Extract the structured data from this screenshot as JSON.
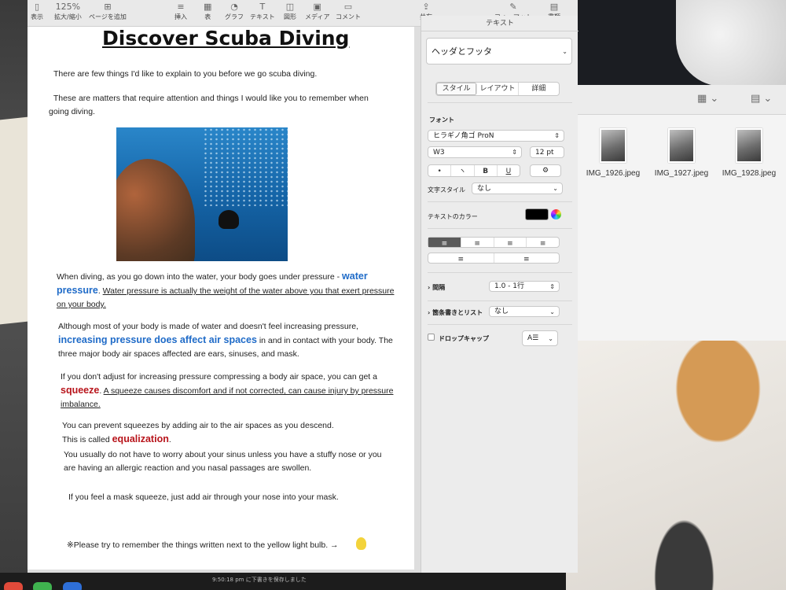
{
  "toolbar": {
    "items": [
      {
        "label": "表示",
        "icon": "sidebar-icon"
      },
      {
        "label": "拡大/縮小",
        "icon": "zoom-value",
        "value": "125%"
      },
      {
        "label": "ページを追加",
        "icon": "plus-icon"
      },
      {
        "label": "挿入",
        "icon": "list-icon"
      },
      {
        "label": "表",
        "icon": "table-icon"
      },
      {
        "label": "グラフ",
        "icon": "chart-icon"
      },
      {
        "label": "テキスト",
        "icon": "text-icon"
      },
      {
        "label": "図形",
        "icon": "shape-icon"
      },
      {
        "label": "メディア",
        "icon": "media-icon"
      },
      {
        "label": "コメント",
        "icon": "comment-icon"
      },
      {
        "label": "共有",
        "icon": "share-icon"
      },
      {
        "label": "フォーマット",
        "icon": "format-icon"
      },
      {
        "label": "書類",
        "icon": "document-icon"
      }
    ]
  },
  "document": {
    "title": "Discover Scuba Diving",
    "p1": "There are few things I'd like to explain to you before we go scuba diving.",
    "p2": "These are matters that require attention and things I would like you to remember when going diving.",
    "p3_a": "When diving, as you go down into the water, your body goes under pressure - ",
    "p3_hl": "water pressure",
    "p3_b": ". ",
    "p3_u": "Water pressure is actually the weight of the water above you that exert pressure on your body.",
    "p4_a": "Although most of your body is made of water and doesn't feel increasing pressure, ",
    "p4_hl": "increasing pressure does affect air spaces",
    "p4_b": " in and in contact with your body. The three major body air spaces affected are ears, sinuses, and mask.",
    "p5_a": "If you don't adjust for increasing pressure compressing a body air space, you can get a ",
    "p5_hl": "squeeze",
    "p5_b": ". ",
    "p5_u": "A squeeze causes discomfort and if not corrected, can cause injury by pressure imbalance.",
    "p6_a": "You can prevent squeezes by adding air to the air spaces as you descend.",
    "p6_b": "This is called ",
    "p6_hl": "equalization",
    "p6_c": ".",
    "p7": "You usually do not have to worry about your sinus unless you have a stuffy nose or you are having an allergic reaction and you nasal passages are swollen.",
    "p8": "If you feel a mask squeeze, just add air through your nose into your mask.",
    "note": "※Please try to remember the things written next to  the yellow light bulb.  →"
  },
  "inspector": {
    "header": "テキスト",
    "style_preset": "ヘッダとフッタ",
    "tabs": [
      "スタイル",
      "レイアウト",
      "詳細"
    ],
    "font_section": "フォント",
    "font_family": "ヒラギノ角ゴ ProN",
    "font_weight": "W3",
    "font_size": "12 pt",
    "format_buttons": [
      "•",
      "ヽ",
      "B",
      "U",
      "⚙"
    ],
    "char_style_label": "文字スタイル",
    "char_style_value": "なし",
    "text_color_label": "テキストのカラー",
    "text_color": "#000000",
    "spacing_label": "間隔",
    "spacing_value": "1.0 - 1行",
    "bullets_label": "箇条書きとリスト",
    "bullets_value": "なし",
    "dropcap_label": "ドロップキャップ"
  },
  "finder": {
    "files": [
      "IMG_1926.jpeg",
      "IMG_1927.jpeg",
      "IMG_1928.jpeg"
    ]
  },
  "status_bar": "9:50:18 pm に下書きを保存しました"
}
